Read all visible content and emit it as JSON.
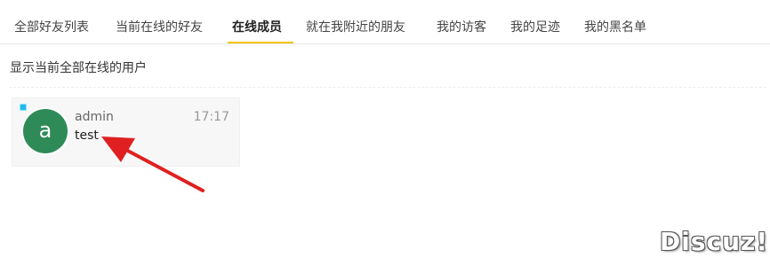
{
  "tabs": [
    {
      "label": "全部好友列表",
      "active": false
    },
    {
      "label": "当前在线的好友",
      "active": false
    },
    {
      "label": "在线成员",
      "active": true
    },
    {
      "label": "就在我附近的朋友",
      "active": false
    },
    {
      "label": "我的访客",
      "active": false
    },
    {
      "label": "我的足迹",
      "active": false
    },
    {
      "label": "我的黑名单",
      "active": false
    }
  ],
  "subtitle": "显示当前全部在线的用户",
  "members": [
    {
      "avatar_letter": "a",
      "username": "admin",
      "time": "17:17",
      "status": "test",
      "online": true,
      "avatar_color": "#2e8b57"
    }
  ],
  "watermark": "Discuz!",
  "colors": {
    "tab_underline": "#f5c400",
    "arrow": "#e02020"
  }
}
